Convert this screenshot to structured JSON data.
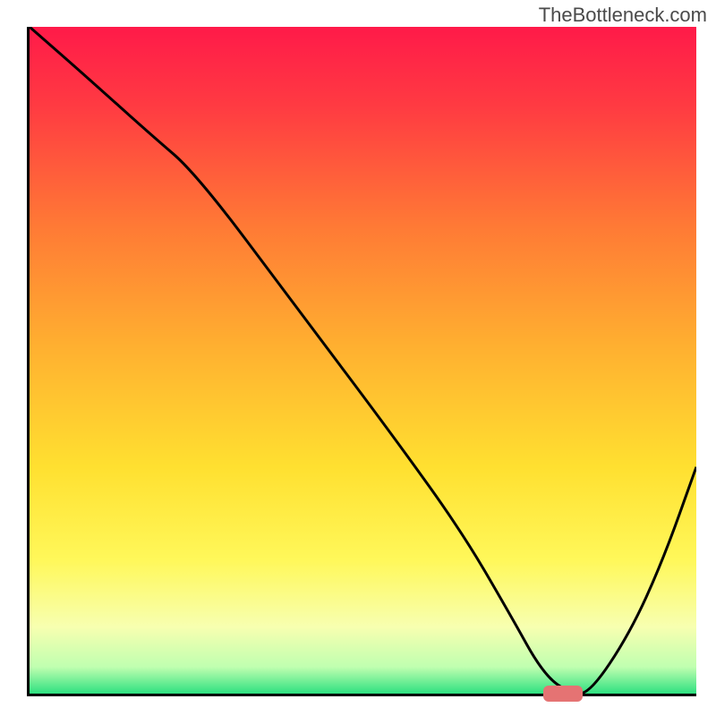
{
  "watermark": "TheBottleneck.com",
  "chart_data": {
    "type": "line",
    "title": "",
    "xlabel": "",
    "ylabel": "",
    "xlim": [
      0,
      100
    ],
    "ylim": [
      0,
      100
    ],
    "grid": false,
    "legend": false,
    "background_gradient": {
      "stops": [
        {
          "pos": 0.0,
          "color": "#ff1a49"
        },
        {
          "pos": 0.12,
          "color": "#ff3b42"
        },
        {
          "pos": 0.3,
          "color": "#ff7a35"
        },
        {
          "pos": 0.48,
          "color": "#ffb030"
        },
        {
          "pos": 0.66,
          "color": "#ffe030"
        },
        {
          "pos": 0.8,
          "color": "#fff85a"
        },
        {
          "pos": 0.9,
          "color": "#f7ffb0"
        },
        {
          "pos": 0.96,
          "color": "#c0ffb0"
        },
        {
          "pos": 1.0,
          "color": "#2ee080"
        }
      ]
    },
    "series": [
      {
        "name": "curve",
        "type": "line",
        "color": "#000000",
        "x": [
          0,
          8,
          18,
          25,
          40,
          55,
          65,
          72,
          77,
          81,
          84,
          90,
          95,
          100
        ],
        "y": [
          100,
          93,
          84,
          78,
          58,
          38,
          24,
          12,
          3,
          0,
          0,
          9,
          20,
          34
        ]
      }
    ],
    "marker": {
      "color": "#e57373",
      "x_center": 80,
      "y": 0,
      "width_pct": 6,
      "height_pct": 1.5
    }
  }
}
